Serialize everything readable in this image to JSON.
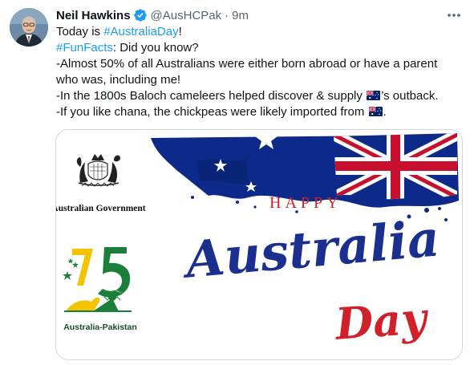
{
  "tweet": {
    "author_name": "Neil Hawkins",
    "handle": "@AusHCPak",
    "separator": "·",
    "time": "9m",
    "line1": {
      "prefix": "Today is ",
      "hashtag": "#AustraliaDay",
      "suffix": "!"
    },
    "line2": {
      "hashtag": "#FunFacts",
      "suffix": ": Did you know?"
    },
    "line3": "-Almost 50% of all Australians were either born abroad or have a parent",
    "line4": "who was, including me!",
    "line5": {
      "prefix": "-In the 1800s Baloch cameleers helped discover & supply ",
      "suffix": "’s outback."
    },
    "line6": {
      "prefix": "-If you like chana, the chickpeas were likely imported from ",
      "suffix": "."
    }
  },
  "media": {
    "gov_label": "Australian Government",
    "anniversary_number": "75",
    "anniversary_label": "Australia-Pakistan",
    "happy_text": "HAPPY",
    "australia_text": "Australia",
    "day_text": "Day"
  },
  "icons": {
    "verified": "verified-badge-icon",
    "more": "more-options-icon",
    "flag": "australia-flag-emoji"
  },
  "colors": {
    "link": "#1d9bf0",
    "text": "#0f1419",
    "secondary": "#536471",
    "flag_blue": "#012169",
    "flag_red": "#e4002b",
    "green": "#1b7f3b",
    "yellow": "#f3c300"
  }
}
